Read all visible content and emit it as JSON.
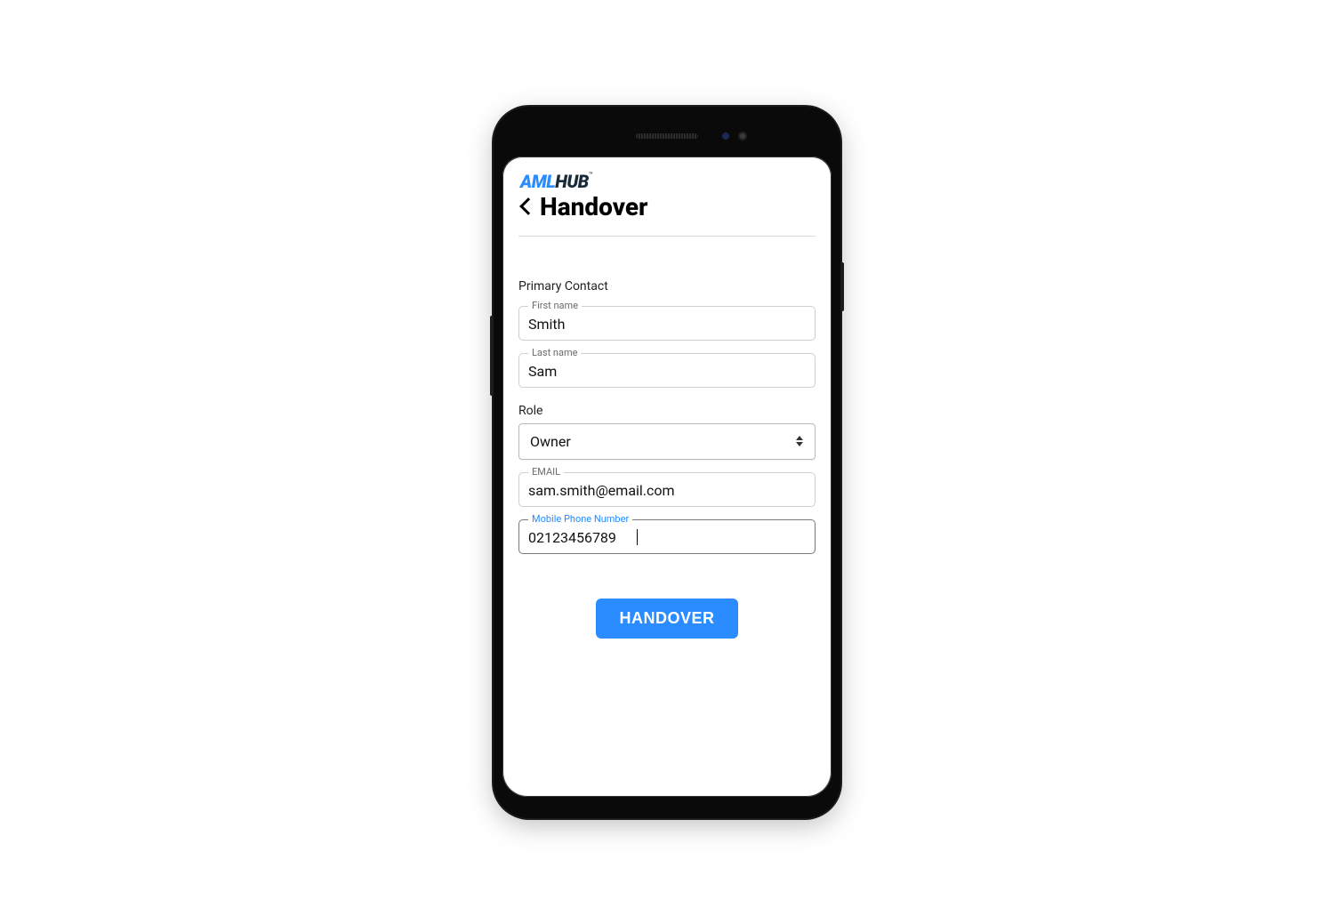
{
  "logo": {
    "part1": "AML",
    "part2": "HUB",
    "tm": "™"
  },
  "header": {
    "title": "Handover"
  },
  "form": {
    "section_label": "Primary Contact",
    "first_name": {
      "label": "First name",
      "value": "Smith"
    },
    "last_name": {
      "label": "Last name",
      "value": "Sam"
    },
    "role": {
      "label": "Role",
      "value": "Owner"
    },
    "email": {
      "label": "EMAIL",
      "value": "sam.smith@email.com"
    },
    "phone": {
      "label": "Mobile Phone Number",
      "value": "02123456789"
    }
  },
  "cta": {
    "label": "HANDOVER"
  },
  "colors": {
    "accent": "#2a8cff"
  }
}
